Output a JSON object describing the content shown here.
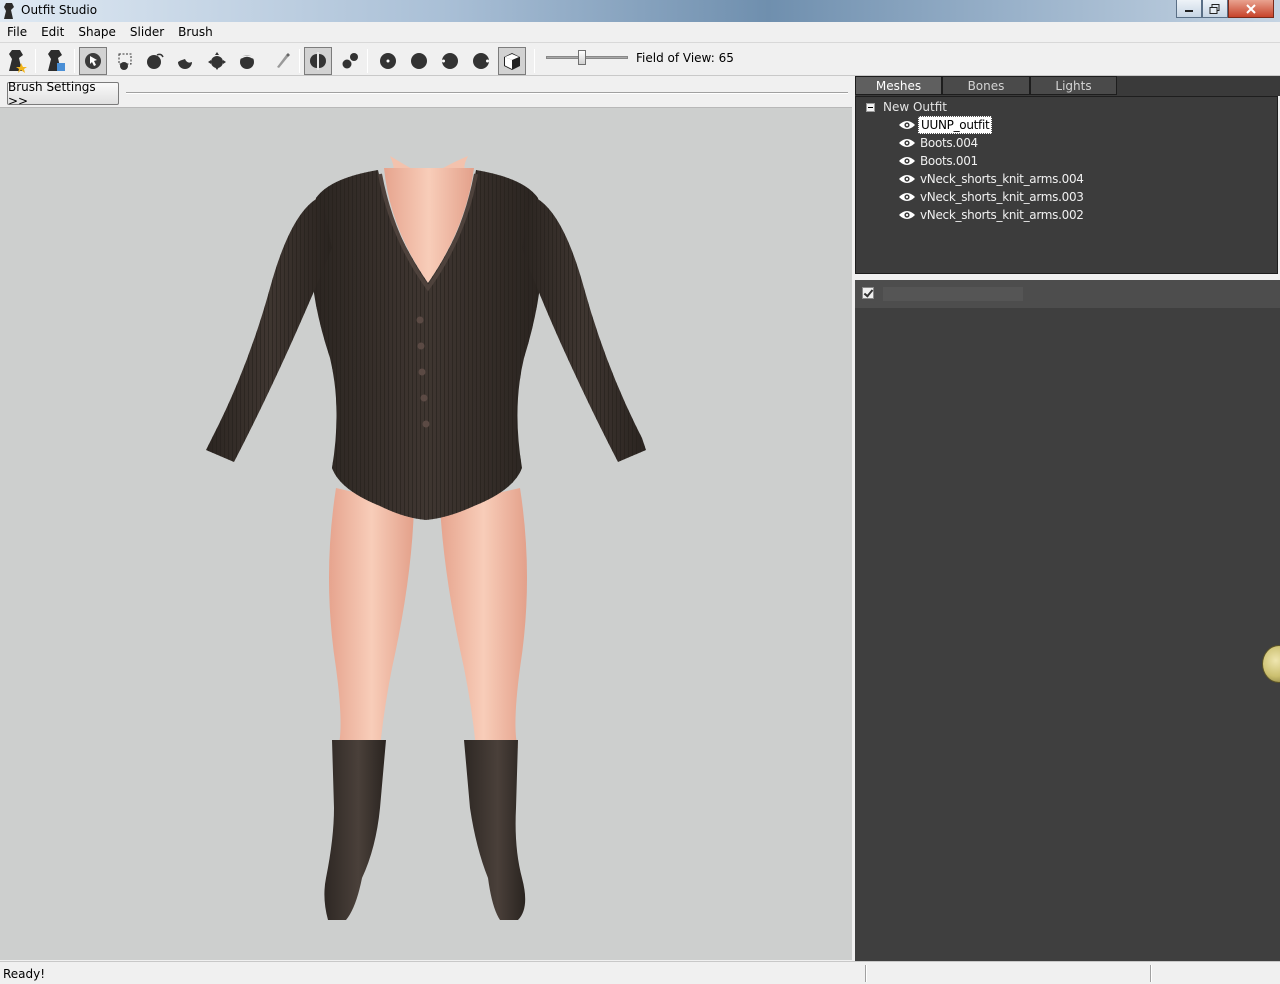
{
  "window": {
    "title": "Outfit Studio"
  },
  "menu": {
    "items": [
      "File",
      "Edit",
      "Shape",
      "Slider",
      "Brush"
    ]
  },
  "toolbar": {
    "tools": [
      {
        "name": "new-project-icon"
      },
      {
        "name": "load-reference-icon"
      },
      {
        "name": "select-brush-icon",
        "active": true
      },
      {
        "name": "mask-brush-icon"
      },
      {
        "name": "inflate-brush-icon"
      },
      {
        "name": "deflate-brush-icon"
      },
      {
        "name": "move-brush-icon"
      },
      {
        "name": "smooth-brush-icon"
      },
      {
        "name": "weight-brush-icon"
      },
      {
        "name": "x-mirror-icon",
        "active": true
      },
      {
        "name": "connected-only-icon"
      },
      {
        "name": "view-front-icon"
      },
      {
        "name": "view-back-icon"
      },
      {
        "name": "view-left-icon"
      },
      {
        "name": "view-right-icon"
      },
      {
        "name": "perspective-cube-icon",
        "active": true
      }
    ],
    "fov_label": "Field of View: 65",
    "fov_value": 65
  },
  "viewport": {
    "brush_settings_label": "Brush Settings >>",
    "background_color": "#cdcfce"
  },
  "panel": {
    "tabs": [
      "Meshes",
      "Bones",
      "Lights"
    ],
    "active_tab": "Meshes",
    "tree": {
      "root": "New Outfit",
      "items": [
        {
          "label": "UUNP_outfit",
          "selected": true
        },
        {
          "label": "Boots.004"
        },
        {
          "label": "Boots.001"
        },
        {
          "label": "vNeck_shorts_knit_arms.004"
        },
        {
          "label": "vNeck_shorts_knit_arms.003"
        },
        {
          "label": "vNeck_shorts_knit_arms.002"
        }
      ]
    },
    "slider_filter_checked": true
  },
  "status": {
    "text": "Ready!"
  }
}
